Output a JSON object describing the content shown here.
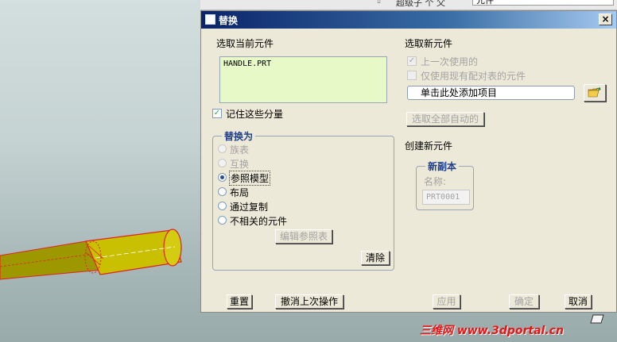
{
  "topbar": {
    "label": "超级子 个 父",
    "field_value": "元件"
  },
  "dialog": {
    "title": "替换",
    "close_glyph": "×",
    "left": {
      "heading": "选取当前元件",
      "current_item": "HANDLE.PRT",
      "remember_label": "记住这些分量",
      "remember_checked": true,
      "replace_by": {
        "title": "替换为",
        "options": [
          {
            "label": "族表",
            "enabled": false,
            "selected": false
          },
          {
            "label": "互换",
            "enabled": false,
            "selected": false
          },
          {
            "label": "参照模型",
            "enabled": true,
            "selected": true
          },
          {
            "label": "布局",
            "enabled": true,
            "selected": false
          },
          {
            "label": "通过复制",
            "enabled": true,
            "selected": false
          },
          {
            "label": "不相关的元件",
            "enabled": true,
            "selected": false
          }
        ],
        "edit_ref_button": "编辑参照表",
        "clear_button": "清除"
      }
    },
    "right": {
      "heading": "选取新元件",
      "last_used_label": "上一次使用的",
      "only_ref_label": "仅使用现有配对表的元件",
      "add_item_field": "单击此处添加项目",
      "select_all_auto": "选取全部自动的",
      "create_heading": "创建新元件",
      "new_copy": {
        "title": "新副本",
        "name_label": "名称:",
        "name_value": "PRT0001"
      }
    },
    "footer": {
      "reset": "重置",
      "undo": "撤消上次操作",
      "apply": "应用",
      "ok": "确定",
      "cancel": "取消"
    }
  },
  "watermark": "三维网 www.3dportal.cn",
  "colors": {
    "list_bg": "#e6f9c6",
    "part_fill": "#c8c000",
    "part_edge": "#e02020"
  }
}
